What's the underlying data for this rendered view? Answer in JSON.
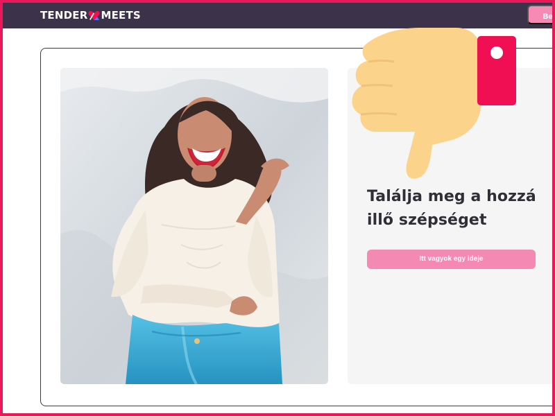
{
  "header": {
    "logo_text_left": "TENDER",
    "logo_text_right": "MEETS",
    "login_label": "Belé"
  },
  "hero": {
    "headline": "Találja meg a hozzá illő szépséget",
    "cta_label": "Itt vagyok egy ideje"
  },
  "overlay": {
    "icon": "thumbs-down-icon"
  },
  "colors": {
    "border": "#e8195a",
    "topbar": "#3c3249",
    "accent": "#f48ab3",
    "panel": "#f5f5f5",
    "thumb": "#fbd38b",
    "cuff": "#ef0f52"
  }
}
